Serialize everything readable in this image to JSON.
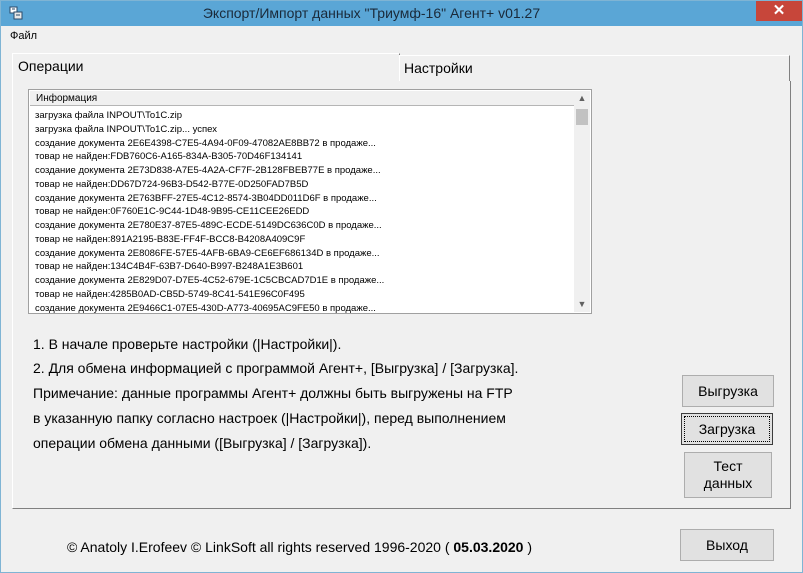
{
  "window": {
    "title": "Экспорт/Импорт данных \"Триумф-16\" Агент+ v01.27",
    "close_symbol": "✕"
  },
  "menu": {
    "file": "Файл"
  },
  "tabs": [
    {
      "label": "Операции"
    },
    {
      "label": "Настройки"
    }
  ],
  "log": {
    "header": "Информация",
    "rows": [
      "загрузка файла INPOUT\\To1C.zip",
      "загрузка файла INPOUT\\To1C.zip... успех",
      "создание документа 2E6E4398-C7E5-4A94-0F09-47082AE8BB72 в продаже...",
      "товар не найден:FDB760C6-A165-834A-B305-70D46F134141",
      "создание документа 2E73D838-A7E5-4A2A-CF7F-2B128FBEB77E в продаже...",
      "товар не найден:DD67D724-96B3-D542-B77E-0D250FAD7B5D",
      "создание документа 2E763BFF-27E5-4C12-8574-3B04DD011D6F в продаже...",
      "товар не найден:0F760E1C-9C44-1D48-9B95-CE11CEE26EDD",
      "создание документа 2E780E37-87E5-489C-ECDE-5149DC636C0D в продаже...",
      "товар не найден:891A2195-B83E-FF4F-BCC8-B4208A409C9F",
      "создание документа 2E8086FE-57E5-4AFB-6BA9-CE6EF686134D в продаже...",
      "товар не найден:134C4B4F-63B7-D640-B997-B248A1E3B601",
      "создание документа 2E829D07-D7E5-4C52-679E-1C5CBCAD7D1E в продаже...",
      "товар не найден:4285B0AD-CB5D-5749-8C41-541E96C0F495",
      "создание документа 2E9466C1-07E5-430D-A773-40695AC9FE50 в продаже..."
    ]
  },
  "instructions": [
    "1. В начале проверьте настройки (|Настройки|).",
    "2. Для обмена информацией с программой Агент+,  [Выгрузка] / [Загрузка].",
    "Примечание: данные программы Агент+ должны быть выгружены на FTP",
    "в указанную папку согласно настроек (|Настройки|), перед выполнением",
    "операции обмена данными ([Выгрузка] / [Загрузка])."
  ],
  "buttons": {
    "export": "Выгрузка",
    "import": "Загрузка",
    "test_line1": "Тест",
    "test_line2": "данных",
    "exit": "Выход"
  },
  "footer": {
    "author": "©  Anatoly I.Erofeev  ©  LinkSoft all rights reserved 1996-2020 (",
    "date": "05.03.2020",
    "close_paren": ")"
  },
  "colors": {
    "titlebar": "#5aa6d6",
    "close": "#c7463a"
  }
}
